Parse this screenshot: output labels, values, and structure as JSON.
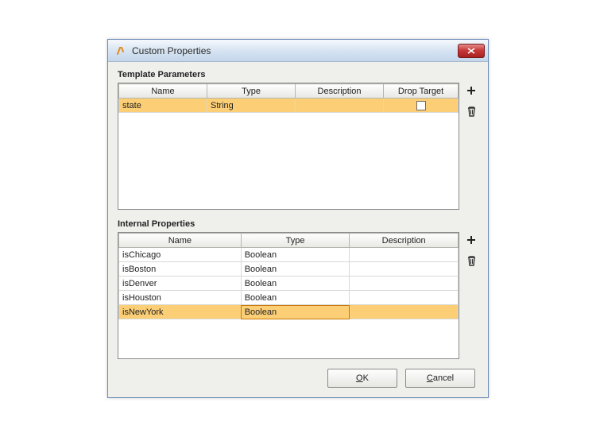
{
  "window": {
    "title": "Custom Properties"
  },
  "sections": {
    "template": {
      "label": "Template Parameters",
      "headers": {
        "name": "Name",
        "type": "Type",
        "description": "Description",
        "dropTarget": "Drop Target"
      },
      "rows": [
        {
          "name": "state",
          "type": "String",
          "description": "",
          "dropTarget": false,
          "selected": true
        }
      ]
    },
    "internal": {
      "label": "Internal Properties",
      "headers": {
        "name": "Name",
        "type": "Type",
        "description": "Description"
      },
      "rows": [
        {
          "name": "isChicago",
          "type": "Boolean",
          "description": "",
          "selected": false
        },
        {
          "name": "isBoston",
          "type": "Boolean",
          "description": "",
          "selected": false
        },
        {
          "name": "isDenver",
          "type": "Boolean",
          "description": "",
          "selected": false
        },
        {
          "name": "isHouston",
          "type": "Boolean",
          "description": "",
          "selected": false
        },
        {
          "name": "isNewYork",
          "type": "Boolean",
          "description": "",
          "selected": true
        }
      ]
    }
  },
  "buttons": {
    "ok_prefix": "O",
    "ok_rest": "K",
    "cancel_prefix": "C",
    "cancel_rest": "ancel"
  }
}
